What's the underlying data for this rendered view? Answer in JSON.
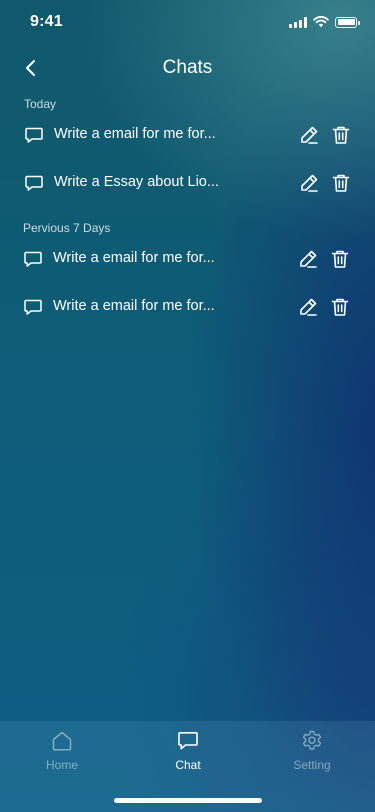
{
  "status_bar": {
    "time": "9:41",
    "icons": [
      "signal-icon",
      "wifi-icon",
      "battery-icon"
    ]
  },
  "header": {
    "title": "Chats",
    "back_icon": "chevron-left-icon"
  },
  "sections": [
    {
      "label": "Today",
      "items": [
        {
          "title": "Write a email for me for..."
        },
        {
          "title": "Write a Essay about Lio..."
        }
      ]
    },
    {
      "label": "Pervious 7 Days",
      "items": [
        {
          "title": "Write a email for me for..."
        },
        {
          "title": "Write a email for me for..."
        }
      ]
    }
  ],
  "row_icons": {
    "chat": "chat-bubble-icon",
    "edit": "pencil-icon",
    "delete": "trash-icon"
  },
  "bottom_nav": {
    "items": [
      {
        "label": "Home",
        "icon": "home-icon",
        "active": false
      },
      {
        "label": "Chat",
        "icon": "chat-bubble-icon",
        "active": true
      },
      {
        "label": "Setting",
        "icon": "gear-icon",
        "active": false
      }
    ]
  },
  "colors": {
    "text": "#ffffff",
    "inactive_text": "#8fb3c4",
    "background_top": "#10586b",
    "background_bottom": "#0d5f86"
  }
}
